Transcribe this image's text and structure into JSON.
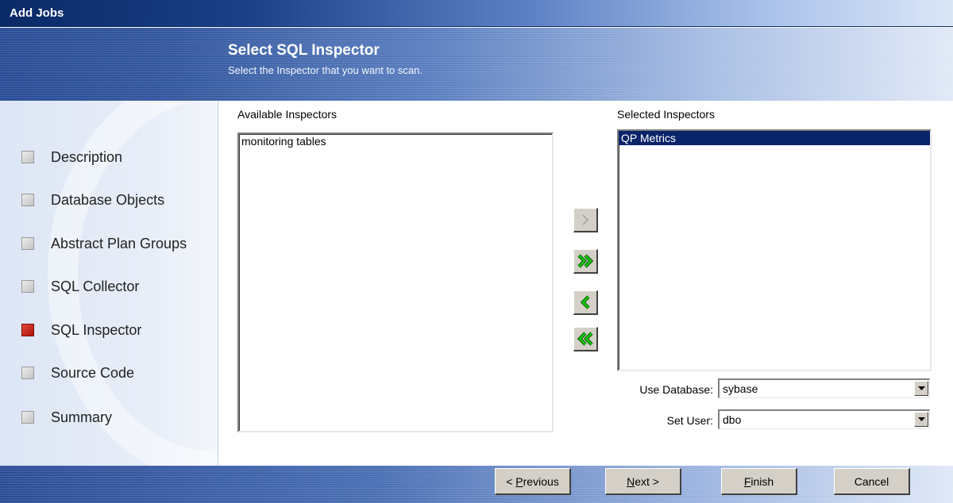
{
  "window": {
    "title": "Add Jobs"
  },
  "header": {
    "title": "Select SQL Inspector",
    "subtitle": "Select the Inspector that you want to scan."
  },
  "steps": [
    {
      "label": "Description",
      "active": false
    },
    {
      "label": "Database Objects",
      "active": false
    },
    {
      "label": "Abstract Plan Groups",
      "active": false
    },
    {
      "label": "SQL Collector",
      "active": false
    },
    {
      "label": "SQL Inspector",
      "active": true
    },
    {
      "label": "Source Code",
      "active": false
    },
    {
      "label": "Summary",
      "active": false
    }
  ],
  "available": {
    "label": "Available Inspectors",
    "items": [
      "monitoring tables"
    ]
  },
  "selected": {
    "label": "Selected Inspectors",
    "items": [
      "QP Metrics"
    ],
    "selected_item": "QP Metrics"
  },
  "transfer_buttons": {
    "add_one": {
      "glyph": ">",
      "enabled": false
    },
    "add_all": {
      "glyph": ">>",
      "enabled": true
    },
    "remove_one": {
      "glyph": "<",
      "enabled": true
    },
    "remove_all": {
      "glyph": "<<",
      "enabled": true
    }
  },
  "use_database": {
    "label": "Use Database:",
    "value": "sybase"
  },
  "set_user": {
    "label": "Set User:",
    "value": "dbo"
  },
  "buttons": {
    "previous": {
      "prefix": "< ",
      "mnemonic": "P",
      "rest": "revious"
    },
    "next": {
      "mnemonic": "N",
      "rest": "ext >"
    },
    "finish": {
      "mnemonic": "F",
      "rest": "inish"
    },
    "cancel": {
      "label": "Cancel"
    }
  },
  "colors": {
    "selection": "#0a246a",
    "active_step": "#c0180c",
    "arrow_green": "#17c80d",
    "dialog_face": "#d4d0c8"
  }
}
